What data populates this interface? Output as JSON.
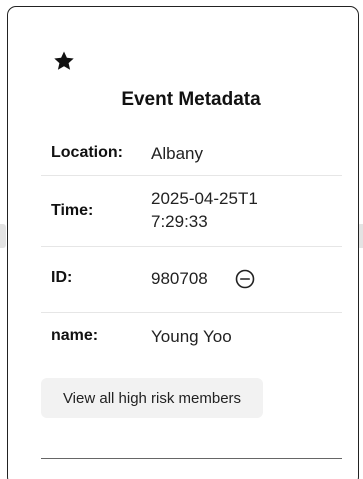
{
  "card": {
    "title": "Event Metadata",
    "header_icon": "star-icon",
    "fields": [
      {
        "label": "Location:",
        "value": "Albany"
      },
      {
        "label": "Time:",
        "value": "2025-04-25T17:29:33"
      },
      {
        "label": "ID:",
        "value": "980708",
        "action_icon": "minus-circle-icon"
      },
      {
        "label": "name:",
        "value": "Young Yoo"
      }
    ],
    "button_label": "View all high risk members"
  },
  "colors": {
    "card_border": "#222222",
    "button_bg": "#f2f2f2",
    "row_divider": "#e6e6e6",
    "bottom_divider": "#666666"
  }
}
